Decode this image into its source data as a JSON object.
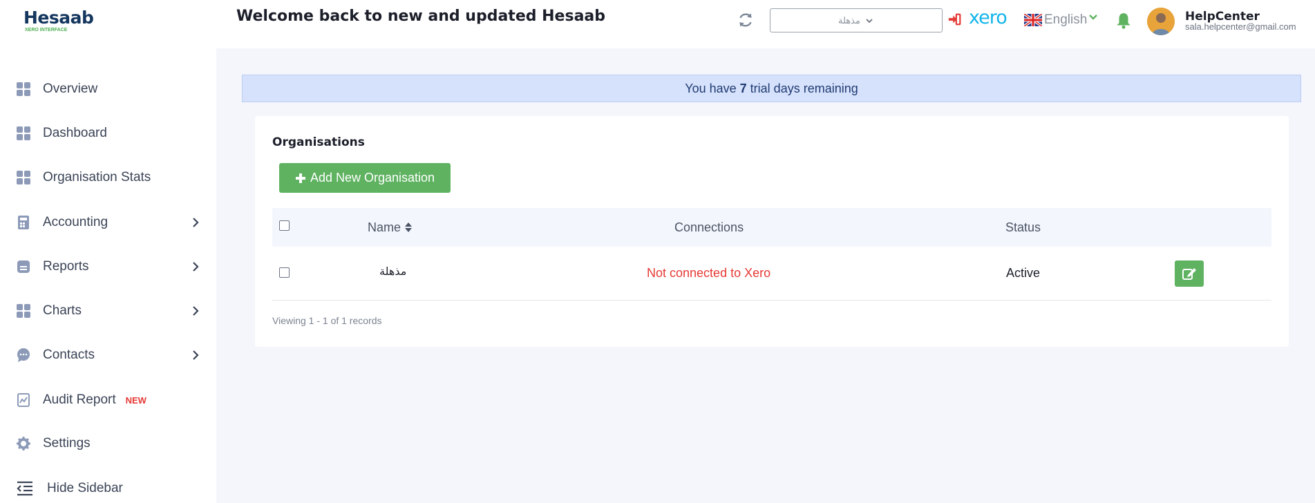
{
  "header": {
    "logo_text": "Hesaab",
    "logo_subtitle": "XERO INTERFACE",
    "welcome": "Welcome back to new and updated Hesaab",
    "org_selector_value": "مذهلة",
    "xero_logo": "xero",
    "language": "English",
    "user_name": "HelpCenter",
    "user_email": "sala.helpcenter@gmail.com"
  },
  "sidebar": {
    "items": [
      {
        "label": "Overview",
        "icon": "grid-icon"
      },
      {
        "label": "Dashboard",
        "icon": "grid-icon"
      },
      {
        "label": "Organisation Stats",
        "icon": "grid-icon"
      },
      {
        "label": "Accounting",
        "icon": "calculator-icon"
      },
      {
        "label": "Reports",
        "icon": "report-icon"
      },
      {
        "label": "Charts",
        "icon": "grid-icon"
      },
      {
        "label": "Contacts",
        "icon": "chat-icon"
      },
      {
        "label": "Audit Report",
        "icon": "audit-icon",
        "badge": "NEW"
      },
      {
        "label": "Settings",
        "icon": "gear-icon"
      },
      {
        "label": "Hide Sidebar",
        "icon": "collapse-icon"
      }
    ]
  },
  "trial": {
    "prefix": "You have",
    "days": "7",
    "suffix": "trial days remaining"
  },
  "organisations": {
    "title": "Organisations",
    "add_button": "Add New Organisation",
    "columns": {
      "name": "Name",
      "connections": "Connections",
      "status": "Status"
    },
    "rows": [
      {
        "name": "مذهلة",
        "connection": "Not connected to Xero",
        "status": "Active"
      }
    ],
    "records_text": "Viewing 1 - 1 of 1 records"
  },
  "colors": {
    "accent_green": "#5eb260",
    "error_red": "#e53935",
    "xero_blue": "#13b5ea",
    "banner_blue": "#d6e2fb"
  }
}
